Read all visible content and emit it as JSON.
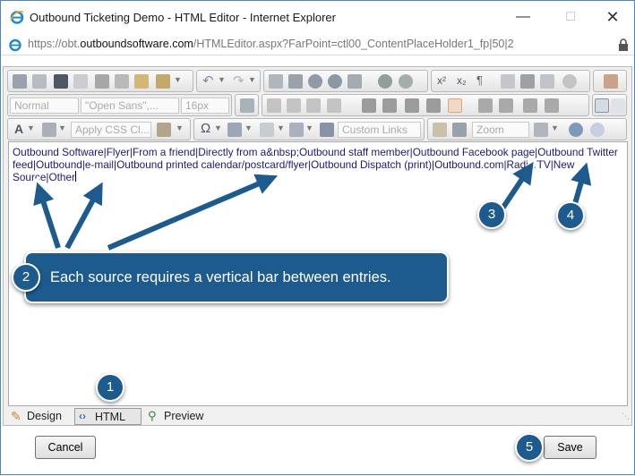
{
  "window": {
    "title": "Outbound Ticketing Demo - HTML Editor - Internet Explorer",
    "minimize_icon": "minimize-icon",
    "maximize_icon": "maximize-icon",
    "close_icon": "close-icon"
  },
  "address": {
    "prefix": "https://obt.",
    "domain": "outboundsoftware.com",
    "path": "/HTMLEditor.aspx?FarPoint=ctl00_ContentPlaceHolder1_fp|50|2"
  },
  "toolbar": {
    "paragraph_style": "Normal",
    "font_name": "\"Open Sans\",...",
    "font_size": "16px",
    "css_class": "Apply CSS Cl...",
    "custom_links": "Custom Links",
    "zoom": "Zoom"
  },
  "editor": {
    "content": "Outbound Software|Flyer|From a friend|Directly from a&nbsp;Outbound staff member|Outbound Facebook page|Outbound Twitter feed|Outbound|e-mail|Outbound printed calendar/postcard/flyer|Outbound Dispatch (print)|Outbound.com|Radio/TV|New Source|Other"
  },
  "modes": {
    "design": "Design",
    "html": "HTML",
    "preview": "Preview"
  },
  "buttons": {
    "cancel": "Cancel",
    "save": "Save"
  },
  "callouts": {
    "step1": "1",
    "step2": "2",
    "step3": "3",
    "step4": "4",
    "step5": "5",
    "step2_text": "Each source requires a vertical bar between entries."
  },
  "colors": {
    "callout": "#1d5b8f",
    "editor_text": "#1a1a7a",
    "window_border": "#4c85c3"
  }
}
